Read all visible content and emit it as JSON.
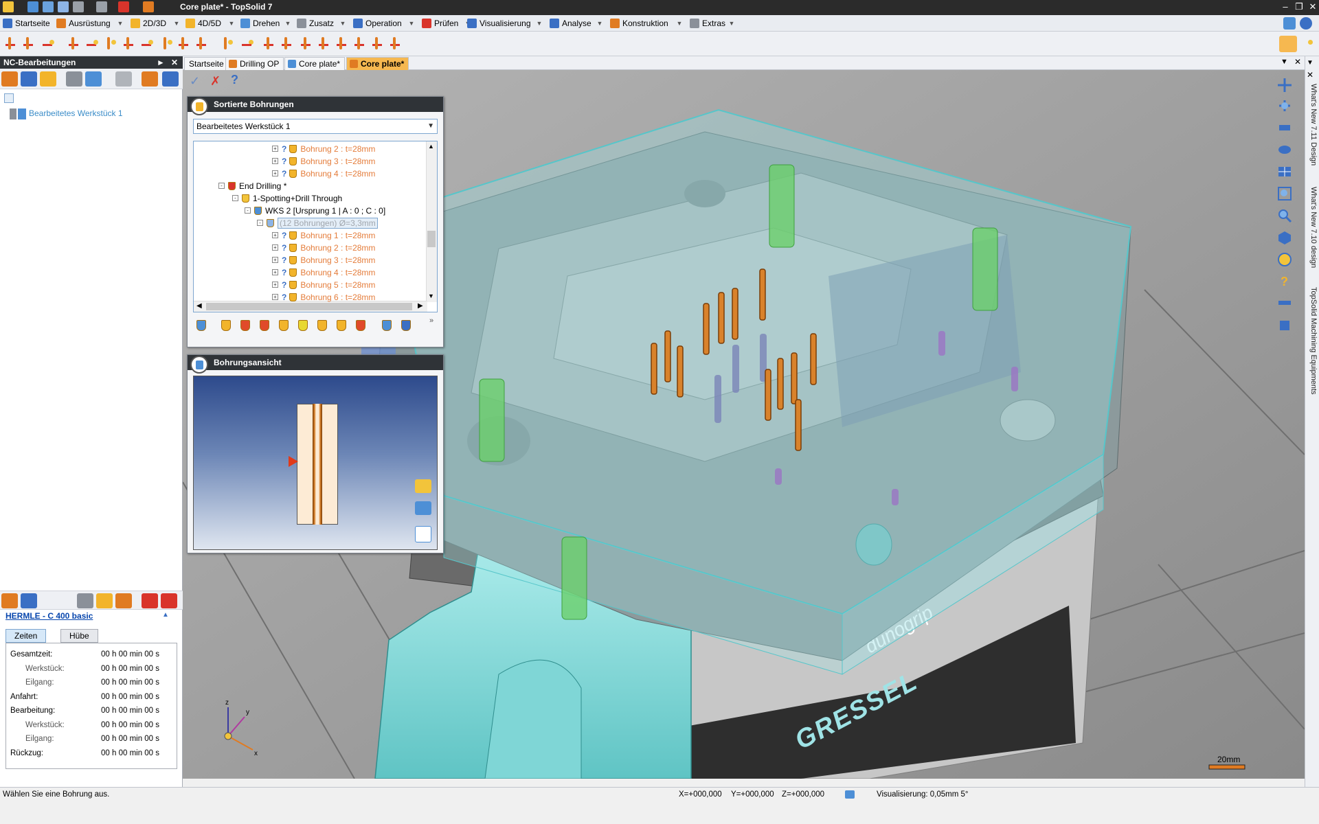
{
  "window": {
    "title": "Core plate* - TopSolid 7",
    "controls": [
      "minimize-icon",
      "restore-icon",
      "close-icon"
    ]
  },
  "menu": {
    "items": [
      "Startseite",
      "Ausrüstung",
      "2D/3D",
      "4D/5D",
      "Drehen",
      "Zusatz",
      "Operation",
      "Prüfen",
      "Visualisierung",
      "Analyse",
      "Konstruktion",
      "Extras"
    ]
  },
  "left_panel": {
    "title": "NC-Bearbeitungen",
    "tree_root": "Bearbeitetes Werkstück 1",
    "machine": "HERMLE - C 400 basic",
    "tabs": [
      "Zeiten",
      "Hübe"
    ],
    "times": [
      {
        "label": "Gesamtzeit:",
        "value": "00 h 00 min 00 s",
        "sub": false
      },
      {
        "label": "Werkstück:",
        "value": "00 h 00 min 00 s",
        "sub": true
      },
      {
        "label": "Eilgang:",
        "value": "00 h 00 min 00 s",
        "sub": true
      },
      {
        "label": "Anfahrt:",
        "value": "00 h 00 min 00 s",
        "sub": false
      },
      {
        "label": "Bearbeitung:",
        "value": "00 h 00 min 00 s",
        "sub": false
      },
      {
        "label": "Werkstück:",
        "value": "00 h 00 min 00 s",
        "sub": true
      },
      {
        "label": "Eilgang:",
        "value": "00 h 00 min 00 s",
        "sub": true
      },
      {
        "label": "Rückzug:",
        "value": "00 h 00 min 00 s",
        "sub": false
      }
    ]
  },
  "doc_tabs": [
    "Startseite",
    "Drilling OP",
    "Core plate*",
    "Core plate*"
  ],
  "sorted_holes": {
    "title": "Sortierte Bohrungen",
    "selected_part": "Bearbeitetes Werkstück 1",
    "tree": [
      {
        "label": "Bohrung 2 : t=28mm",
        "level": 5,
        "kind": "hole"
      },
      {
        "label": "Bohrung 3 : t=28mm",
        "level": 5,
        "kind": "hole"
      },
      {
        "label": "Bohrung 4 : t=28mm",
        "level": 5,
        "kind": "hole"
      },
      {
        "label": "End Drilling *",
        "level": 1,
        "kind": "group"
      },
      {
        "label": "1-Spotting+Drill Through",
        "level": 2,
        "kind": "op"
      },
      {
        "label": "WKS 2 [Ursprung 1 | A : 0 ; C : 0]",
        "level": 3,
        "kind": "wcs"
      },
      {
        "label": "(12 Bohrungen) Ø=3,3mm",
        "level": 4,
        "kind": "set"
      },
      {
        "label": "Bohrung 1 : t=28mm",
        "level": 5,
        "kind": "hole"
      },
      {
        "label": "Bohrung 2 : t=28mm",
        "level": 5,
        "kind": "hole"
      },
      {
        "label": "Bohrung 3 : t=28mm",
        "level": 5,
        "kind": "hole"
      },
      {
        "label": "Bohrung 4 : t=28mm",
        "level": 5,
        "kind": "hole"
      },
      {
        "label": "Bohrung 5 : t=28mm",
        "level": 5,
        "kind": "hole"
      },
      {
        "label": "Bohrung 6 : t=28mm",
        "level": 5,
        "kind": "hole"
      }
    ]
  },
  "hole_view": {
    "title": "Bohrungsansicht"
  },
  "viewport": {
    "scale_label": "20mm",
    "axis_labels": {
      "x": "x",
      "y": "y",
      "z": "z"
    },
    "vise_text": [
      "GRESSEL",
      "dunogrip"
    ]
  },
  "right_bar": {
    "labels": [
      "What's New 7.11 Design",
      "What's New 7.10 design",
      "TopSolid Machining Equipments"
    ]
  },
  "status": {
    "message": "Wählen Sie eine Bohrung aus.",
    "x": "X=+000,000",
    "y": "Y=+000,000",
    "z": "Z=+000,000",
    "visualization": "Visualisierung: 0,05mm 5°"
  },
  "colors": {
    "accent_orange": "#f6b850",
    "dark_header": "#2f3337",
    "glass_cyan": "#9fe3e6",
    "hole_orange": "#d9822b"
  }
}
